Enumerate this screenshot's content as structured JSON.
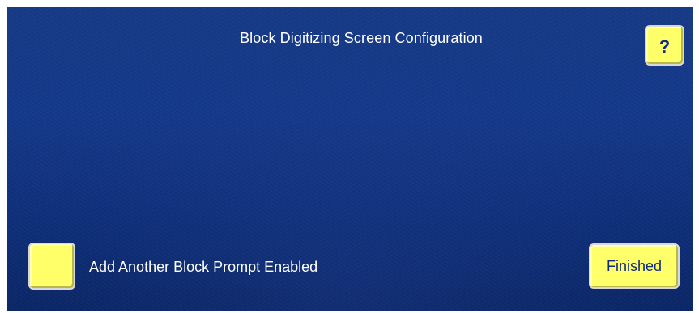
{
  "screen": {
    "title": "Block Digitizing Screen Configuration",
    "background_color": "#15398a",
    "accent_color": "#ffff6a"
  },
  "help_button": {
    "label": "?"
  },
  "add_block_prompt": {
    "label": "Add Another Block Prompt Enabled",
    "checked": false
  },
  "finished_button": {
    "label": "Finished"
  }
}
